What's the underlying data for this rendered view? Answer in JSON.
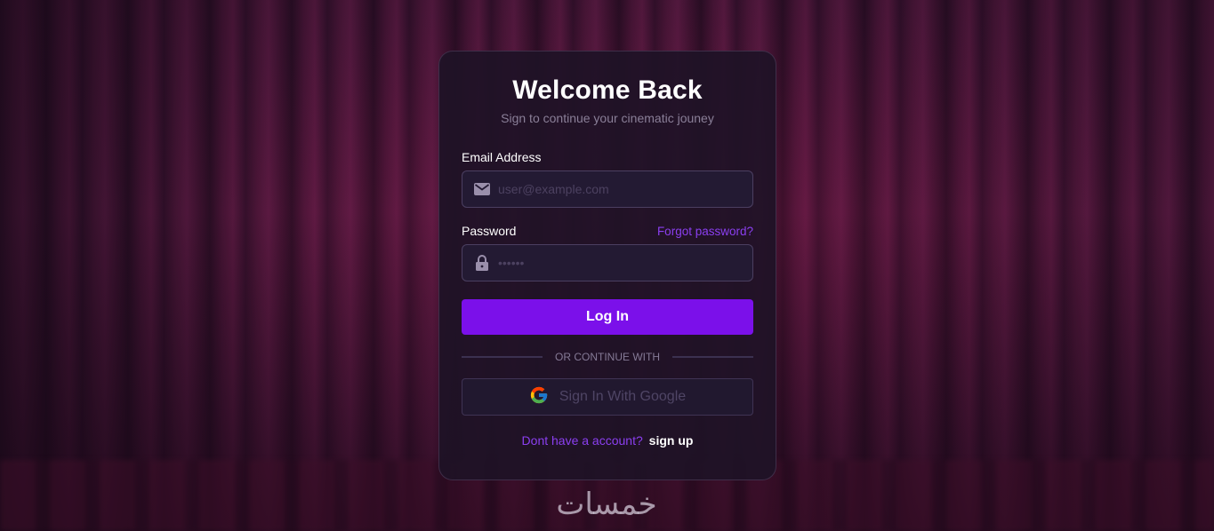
{
  "login": {
    "title": "Welcome Back",
    "subtitle": "Sign to continue your cinematic jouney",
    "email": {
      "label": "Email Address",
      "placeholder": "user@example.com",
      "value": "",
      "icon": "mail-icon"
    },
    "password": {
      "label": "Password",
      "placeholder": "••••••",
      "value": "",
      "icon": "lock-icon",
      "forgot_label": "Forgot password?"
    },
    "login_button": "Log In",
    "divider_text": "OR CONTINUE WITH",
    "google_button": "Sign In With Google",
    "signup_prompt": "Dont have a account?",
    "signup_link": "sign up"
  },
  "watermark": "خمسات",
  "colors": {
    "accent": "#7b10ea",
    "link": "#8b3ff0",
    "card_bg": "#1e1226",
    "text": "#ffffff"
  }
}
